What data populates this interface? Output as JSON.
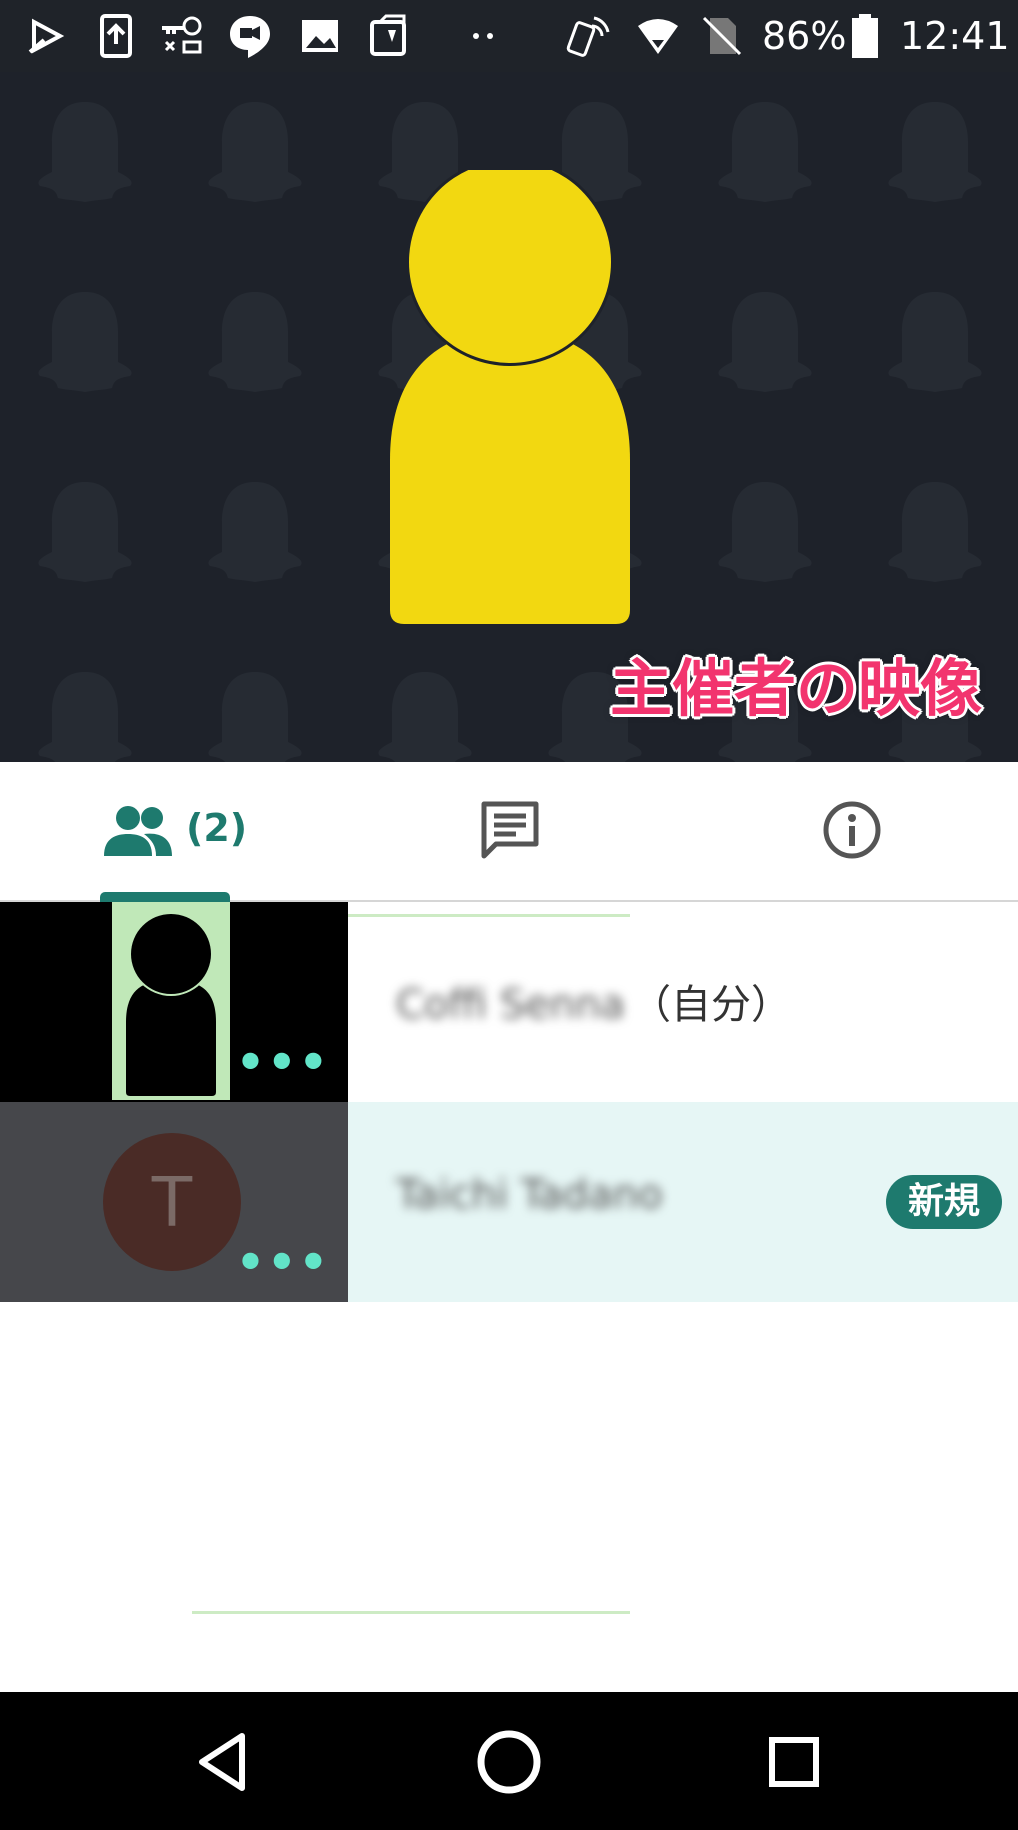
{
  "status_bar": {
    "battery_percent": "86%",
    "time": "12:41",
    "icons": [
      "play-store-icon",
      "upload-icon",
      "vpn-key-icon",
      "hangouts-icon",
      "gallery-icon",
      "clipboard-icon",
      "more-notifications-icon",
      "nfc-phone-icon",
      "wifi-icon",
      "no-sim-icon",
      "battery-icon"
    ]
  },
  "video": {
    "caption": "主催者の映像",
    "placeholder_color": "#f2d811"
  },
  "tabs": {
    "people_count": "(2)",
    "items": [
      {
        "name": "people",
        "icon": "people-icon",
        "active": true
      },
      {
        "name": "chat",
        "icon": "chat-icon",
        "active": false
      },
      {
        "name": "info",
        "icon": "info-icon",
        "active": false
      }
    ]
  },
  "participants": [
    {
      "name": "Coffi Senna",
      "self_label": "（自分）",
      "thumbnail": "avatar-silhouette",
      "more": "•••"
    },
    {
      "name": "Taichi Tadano",
      "avatar_letter": "T",
      "badge": "新規",
      "more": "•••"
    }
  ],
  "colors": {
    "accent": "#1e7a6e",
    "caption": "#f2346e",
    "highlight_row": "#e6f6f5",
    "more_dots": "#62e4c8"
  },
  "nav_bar": {
    "icons": [
      "back-icon",
      "home-icon",
      "recents-icon"
    ]
  }
}
